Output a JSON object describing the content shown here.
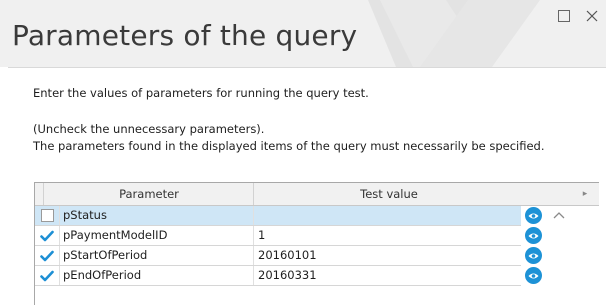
{
  "window": {
    "title": "Parameters of the query",
    "controls": {
      "maximize": "maximize-icon",
      "close": "close-icon"
    }
  },
  "instructions": {
    "line1": "Enter the values of parameters for running the query test.",
    "line2": "(Uncheck the unnecessary parameters).",
    "line3": "The parameters found in the displayed items of the query must necessarily be specified."
  },
  "grid": {
    "columns": {
      "parameter": "Parameter",
      "test_value": "Test value"
    },
    "rows": [
      {
        "checked": false,
        "name": "pStatus",
        "value": "",
        "selected": true
      },
      {
        "checked": true,
        "name": "pPaymentModelID",
        "value": "1",
        "selected": false
      },
      {
        "checked": true,
        "name": "pStartOfPeriod",
        "value": "20160101",
        "selected": false
      },
      {
        "checked": true,
        "name": "pEndOfPeriod",
        "value": "20160331",
        "selected": false
      }
    ]
  },
  "colors": {
    "accent": "#1d92d6",
    "selected_row": "#cfe6f6",
    "header_bg": "#f0f0f0"
  }
}
